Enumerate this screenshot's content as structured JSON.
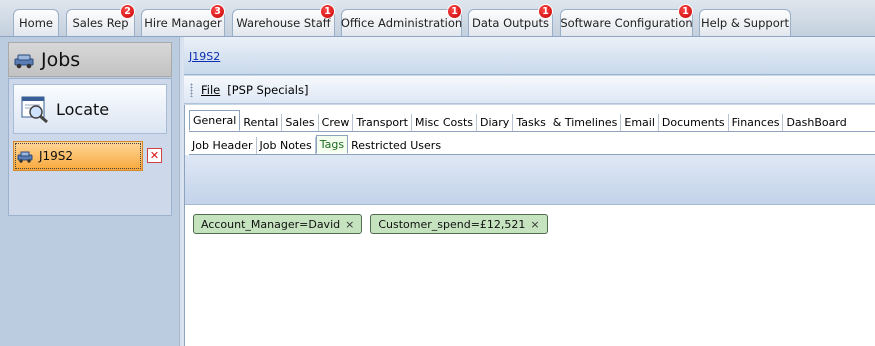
{
  "top_tabs": [
    {
      "label": "Home",
      "badge": ""
    },
    {
      "label": "Sales Rep",
      "badge": "2"
    },
    {
      "label": "Hire Manager",
      "badge": "3"
    },
    {
      "label": "Warehouse Staff",
      "badge": "1"
    },
    {
      "label": "Office Administration",
      "badge": "1"
    },
    {
      "label": "Data Outputs",
      "badge": "1"
    },
    {
      "label": "Software Configuration",
      "badge": "1"
    },
    {
      "label": "Help & Support",
      "badge": ""
    }
  ],
  "left": {
    "title": "Jobs",
    "locate_label": "Locate",
    "job_item": "J19S2"
  },
  "breadcrumb": "J19S2",
  "menu": {
    "file_label": "File",
    "context_label": "[PSP Specials]"
  },
  "main_tabs": [
    "General",
    "Rental",
    "Sales",
    "Crew",
    "Transport",
    "Misc Costs",
    "Diary",
    "Tasks  & Timelines",
    "Email",
    "Documents",
    "Finances",
    "DashBoard"
  ],
  "sub_tabs": [
    "Job Header",
    "Job Notes",
    "Tags",
    "Restricted Users"
  ],
  "tags": [
    {
      "text": "Account_Manager=David",
      "remove": "×"
    },
    {
      "text": "Customer_spend=£12,521",
      "remove": "×"
    }
  ],
  "colors": {
    "selected_job_bg": "#f8a83b",
    "tag_bg": "#c6e3c0",
    "badge": "#d40000",
    "link": "#0a2fb0"
  }
}
